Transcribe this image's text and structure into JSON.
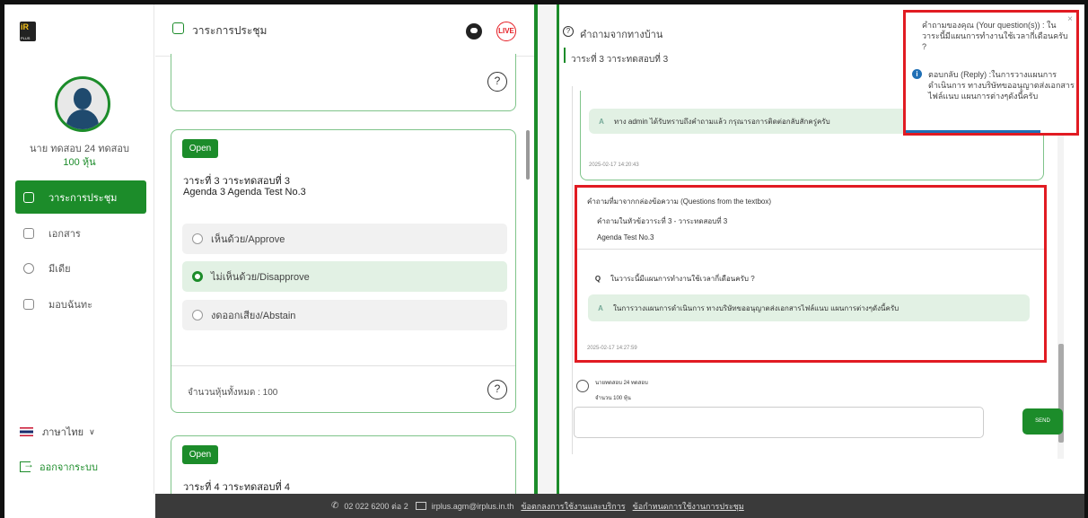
{
  "sidebar": {
    "logo_text": "iR",
    "logo_sub": "PLUS",
    "user_name": "นาย ทดสอบ 24 ทดสอบ",
    "user_shares": "100 หุ้น",
    "items": [
      {
        "label": "วาระการประชุม",
        "active": true
      },
      {
        "label": "เอกสาร",
        "active": false
      },
      {
        "label": "มีเดีย",
        "active": false
      },
      {
        "label": "มอบฉันทะ",
        "active": false
      }
    ],
    "language": "ภาษาไทย",
    "logout": "ออกจากระบบ"
  },
  "agenda": {
    "title": "วาระการประชุม",
    "live_label": "LIVE",
    "help_glyph": "?",
    "cards": [
      {
        "badge": "Open",
        "line1": "วาระที่ 3 วาระทดสอบที่ 3",
        "line2": "Agenda 3 Agenda Test No.3",
        "options": [
          {
            "label": "เห็นด้วย/Approve",
            "selected": false
          },
          {
            "label": "ไม่เห็นด้วย/Disapprove",
            "selected": true
          },
          {
            "label": "งดออกเสียง/Abstain",
            "selected": false
          }
        ],
        "total_shares": "จำนวนหุ้นทั้งหมด : 100"
      },
      {
        "badge": "Open",
        "line1": "วาระที่ 4 วาระทดสอบที่ 4"
      }
    ]
  },
  "qa": {
    "title": "คำถามจากทางบ้าน",
    "subtitle": "วาระที่ 3 วาระทดสอบที่ 3",
    "prev_answer": "ทาง admin ได้รับทราบถึงคำถามแล้ว กรุณารอการติดต่อกลับสักครู่ครับ",
    "prev_time": "2025-02-17 14:20:43",
    "message": {
      "source_title": "คำถามที่มาจากกล่องข้อความ (Questions from the textbox)",
      "topic_line": "คำถามในหัวข้อวาระที่ 3 - วาระทดสอบที่ 3",
      "topic_line2": "Agenda Test No.3",
      "question": "ในวาระนี้มีแผนการทำงานใช้เวลากี่เดือนครับ ?",
      "answer": "ในการวางแผนการดำเนินการ ทางบริษัทขออนุญาตส่งเอกสารไฟล์แนบ แผนการต่างๆดังนี้ครับ",
      "time": "2025-02-17 14:27:59"
    },
    "q_letter": "Q",
    "a_letter": "A",
    "footer_user": "นายทดสอบ 24 ทดสอบ",
    "footer_shares": "จำนวน 100 หุ้น",
    "input_placeholder": "",
    "send_label": "SEND"
  },
  "notification": {
    "question": "คำถามของคุณ (Your question(s)) : ในวาระนี้มีแผนการทำงานใช้เวลากี่เดือนครับ ?",
    "answer": "ตอบกลับ (Reply) :ในการวางแผนการดำเนินการ ทางบริษัทขออนุญาตส่งเอกสารไฟล์แนบ แผนการต่างๆดังนี้ครับ",
    "close_glyph": "×"
  },
  "footer": {
    "phone": "02 022 6200 ต่อ 2",
    "email": "irplus.agm@irplus.in.th",
    "link_terms": "ข้อตกลงการใช้งานและบริการ",
    "link_meeting": "ข้อกำหนดการใช้งานการประชุม"
  },
  "colors": {
    "brand_green": "#1c8c2a",
    "highlight_red": "#e11b22",
    "footer_bg": "#3a3a3a"
  }
}
